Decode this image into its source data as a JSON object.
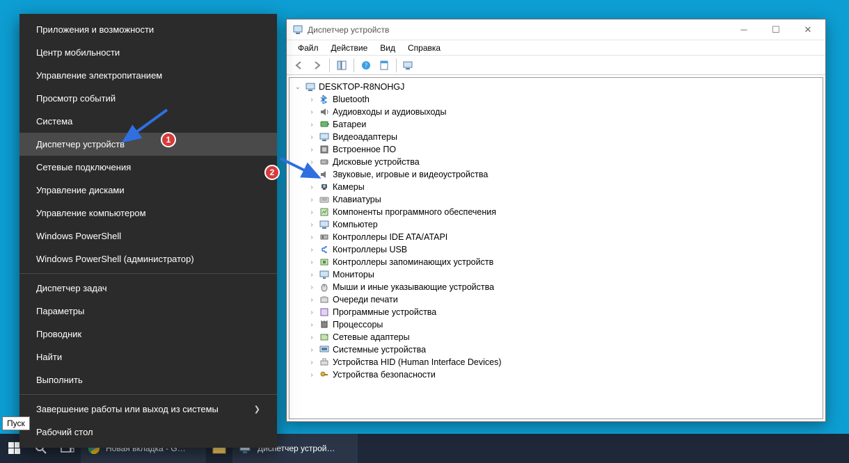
{
  "winx": {
    "groups": [
      [
        "Приложения и возможности",
        "Центр мобильности",
        "Управление электропитанием",
        "Просмотр событий",
        "Система",
        "Диспетчер устройств",
        "Сетевые подключения",
        "Управление дисками",
        "Управление компьютером",
        "Windows PowerShell",
        "Windows PowerShell (администратор)"
      ],
      [
        "Диспетчер задач",
        "Параметры",
        "Проводник",
        "Найти",
        "Выполнить"
      ],
      [
        "Завершение работы или выход из системы",
        "Рабочий стол"
      ]
    ],
    "selected_index": 5,
    "submenu_index_group3": 0
  },
  "markers": {
    "one": "1",
    "two": "2"
  },
  "dm": {
    "title": "Диспетчер устройств",
    "menu": [
      "Файл",
      "Действие",
      "Вид",
      "Справка"
    ],
    "computer": "DESKTOP-R8NOHGJ",
    "categories": [
      "Bluetooth",
      "Аудиовходы и аудиовыходы",
      "Батареи",
      "Видеоадаптеры",
      "Встроенное ПО",
      "Дисковые устройства",
      "Звуковые, игровые и видеоустройства",
      "Камеры",
      "Клавиатуры",
      "Компоненты программного обеспечения",
      "Компьютер",
      "Контроллеры IDE ATA/ATAPI",
      "Контроллеры USB",
      "Контроллеры запоминающих устройств",
      "Мониторы",
      "Мыши и иные указывающие устройства",
      "Очереди печати",
      "Программные устройства",
      "Процессоры",
      "Сетевые адаптеры",
      "Системные устройства",
      "Устройства HID (Human Interface Devices)",
      "Устройства безопасности"
    ]
  },
  "taskbar": {
    "start_tooltip": "Пуск",
    "items": [
      {
        "label": "Новая вкладка - G…",
        "app": "chrome"
      },
      {
        "label": "",
        "app": "explorer"
      },
      {
        "label": "Диспетчер устрой…",
        "app": "devmgr"
      }
    ],
    "search_icon": true,
    "taskview_icon": true
  }
}
